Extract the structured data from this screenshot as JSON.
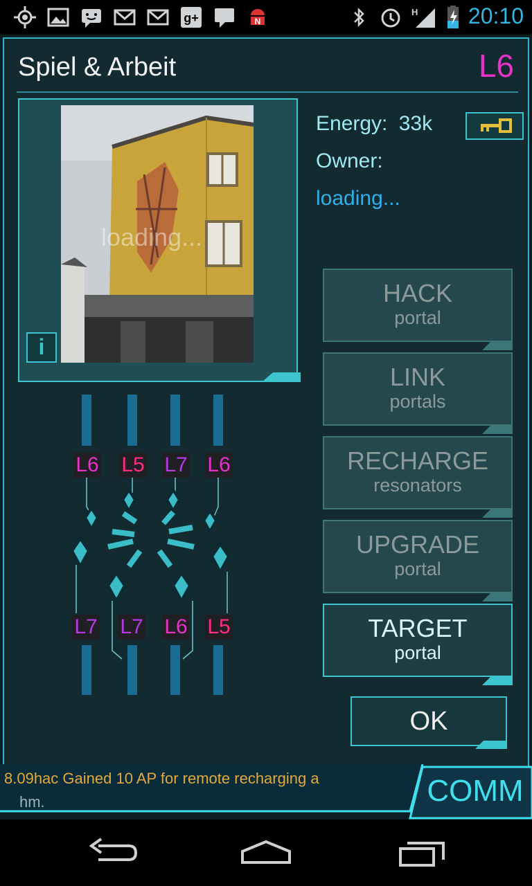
{
  "status_bar": {
    "time": "20:10",
    "icons": [
      "gps-icon",
      "image-icon",
      "chat-icon",
      "gmail-icon",
      "gmail-icon",
      "google-plus-icon",
      "message-icon",
      "android-icon",
      "bluetooth-icon",
      "alarm-icon",
      "signal-icon",
      "battery-icon"
    ]
  },
  "portal": {
    "title": "Spiel & Arbeit",
    "level": "L6",
    "photo_overlay": "loading...",
    "info_button": "i",
    "energy_label": "Energy:",
    "energy_value": "33k",
    "owner_label": "Owner:",
    "owner_value": "loading..."
  },
  "actions": [
    {
      "main": "HACK",
      "sub": "portal",
      "enabled": false
    },
    {
      "main": "LINK",
      "sub": "portals",
      "enabled": false
    },
    {
      "main": "RECHARGE",
      "sub": "resonators",
      "enabled": false
    },
    {
      "main": "UPGRADE",
      "sub": "portal",
      "enabled": false
    },
    {
      "main": "TARGET",
      "sub": "portal",
      "enabled": true
    }
  ],
  "ok_label": "OK",
  "resonators": {
    "top": [
      "L6",
      "L5",
      "L7",
      "L6"
    ],
    "bottom": [
      "L7",
      "L7",
      "L6",
      "L5"
    ]
  },
  "comm": {
    "line1": "8.09hac  Gained 10 AP for remote recharging a",
    "line2": "hm.",
    "button": "COMM"
  },
  "colors": {
    "accent": "#3cc4cf",
    "level_l5": "#ff2c86",
    "level_l6": "#e632c8",
    "level_l7": "#b23be5"
  }
}
